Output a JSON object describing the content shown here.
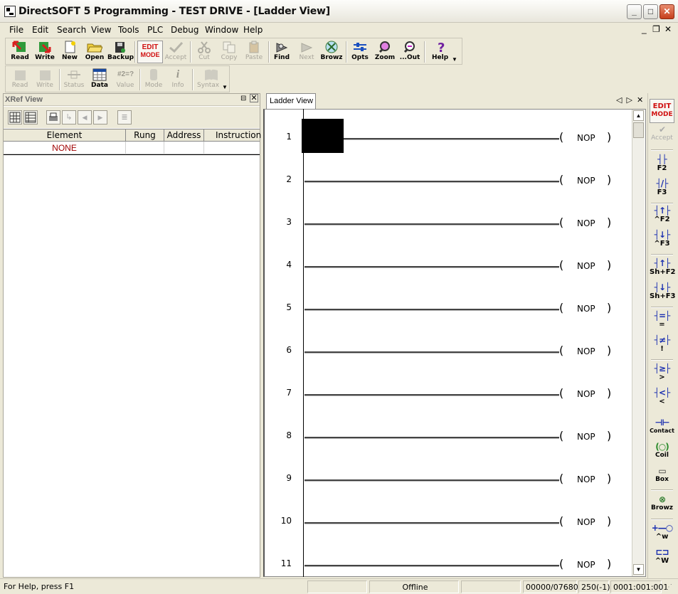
{
  "window": {
    "title": "DirectSOFT 5 Programming - TEST DRIVE - [Ladder View]"
  },
  "menu": [
    "File",
    "Edit",
    "Search",
    "View",
    "Tools",
    "PLC",
    "Debug",
    "Window",
    "Help"
  ],
  "toolbar1": {
    "read": "Read",
    "write": "Write",
    "new": "New",
    "open": "Open",
    "backup": "Backup",
    "edit_mode_line1": "EDIT",
    "edit_mode_line2": "MODE",
    "accept": "Accept",
    "cut": "Cut",
    "copy": "Copy",
    "paste": "Paste",
    "find": "Find",
    "next": "Next",
    "browz": "Browz",
    "opts": "Opts",
    "zoom": "Zoom",
    "out": "...Out",
    "help": "Help"
  },
  "toolbar2": {
    "read": "Read",
    "write": "Write",
    "status": "Status",
    "data": "Data",
    "value": "Value",
    "value_icon": "#2=?",
    "mode": "Mode",
    "info": "Info",
    "syntax": "Syntax"
  },
  "xref": {
    "title": "XRef View",
    "columns": [
      "Element",
      "Rung",
      "Address",
      "Instruction"
    ],
    "rows": [
      {
        "element": "NONE",
        "rung": "",
        "address": "",
        "instruction": ""
      }
    ]
  },
  "ladder": {
    "tab": "Ladder View",
    "rungs": [
      {
        "num": "1",
        "instr": "NOP"
      },
      {
        "num": "2",
        "instr": "NOP"
      },
      {
        "num": "3",
        "instr": "NOP"
      },
      {
        "num": "4",
        "instr": "NOP"
      },
      {
        "num": "5",
        "instr": "NOP"
      },
      {
        "num": "6",
        "instr": "NOP"
      },
      {
        "num": "7",
        "instr": "NOP"
      },
      {
        "num": "8",
        "instr": "NOP"
      },
      {
        "num": "9",
        "instr": "NOP"
      },
      {
        "num": "10",
        "instr": "NOP"
      },
      {
        "num": "11",
        "instr": "NOP"
      }
    ]
  },
  "palette": {
    "edit_line1": "EDIT",
    "edit_line2": "MODE",
    "accept": "Accept",
    "items": [
      {
        "sym": "┤├",
        "key": "F2"
      },
      {
        "sym": "┤/├",
        "key": "F3"
      },
      {
        "sym": "┤↑├",
        "key": "^F2"
      },
      {
        "sym": "┤↓├",
        "key": "^F3"
      },
      {
        "sym": "┤↑├",
        "key": "Sh+F2"
      },
      {
        "sym": "┤↓├",
        "key": "Sh+F3"
      },
      {
        "sym": "┤=├",
        "key": "="
      },
      {
        "sym": "┤≠├",
        "key": "!"
      },
      {
        "sym": "┤≥├",
        "key": ">"
      },
      {
        "sym": "┤<├",
        "key": "<"
      }
    ],
    "contact": "Contact",
    "coil": "Coil",
    "box": "Box",
    "browz": "Browz",
    "w1": "^w",
    "w2": "^W"
  },
  "status": {
    "help": "For Help, press F1",
    "mode": "Offline",
    "memory": "00000/07680",
    "rung": "250(-1)",
    "address": "0001:001:001"
  }
}
